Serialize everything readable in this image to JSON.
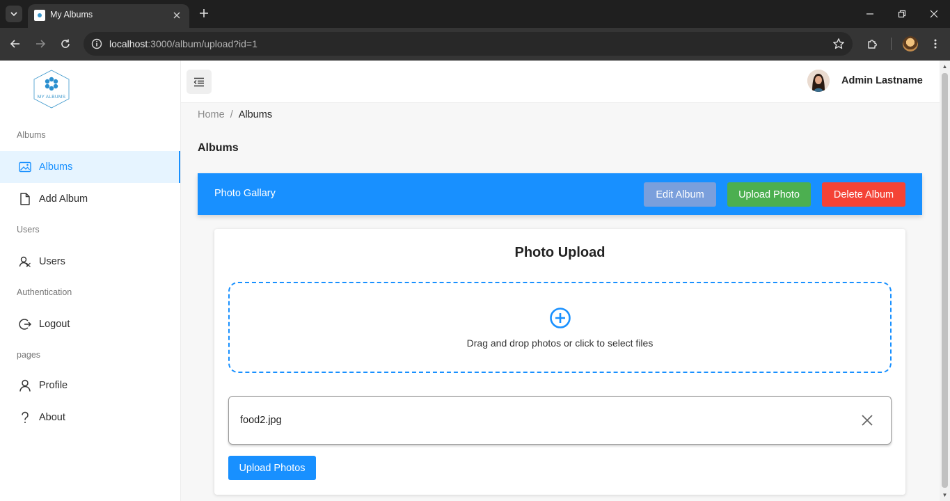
{
  "browser": {
    "tab_title": "My Albums",
    "url_host": "localhost",
    "url_rest": ":3000/album/upload?id=1"
  },
  "sidebar": {
    "logo_text": "MY ALBUMS",
    "sections": [
      {
        "title": "Albums"
      },
      {
        "title": "Users"
      },
      {
        "title": "Authentication"
      },
      {
        "title": "pages"
      }
    ],
    "items": [
      {
        "label": "Albums",
        "icon": "image-icon",
        "active": true
      },
      {
        "label": "Add Album",
        "icon": "file-icon"
      },
      {
        "label": "Users",
        "icon": "users-icon"
      },
      {
        "label": "Logout",
        "icon": "logout-icon"
      },
      {
        "label": "Profile",
        "icon": "user-icon"
      },
      {
        "label": "About",
        "icon": "question-icon"
      }
    ]
  },
  "header": {
    "user_name": "Admin Lastname"
  },
  "breadcrumb": {
    "home": "Home",
    "separator": "/",
    "current": "Albums"
  },
  "page": {
    "title": "Albums"
  },
  "album_bar": {
    "title": "Photo Gallary",
    "edit_label": "Edit Album",
    "upload_label": "Upload Photo",
    "delete_label": "Delete Album"
  },
  "upload": {
    "title": "Photo Upload",
    "dropzone_text": "Drag and drop photos or click to select files",
    "files": [
      "food2.jpg"
    ],
    "submit_label": "Upload Photos"
  },
  "colors": {
    "primary": "#1890ff",
    "edit": "#7a9fdc",
    "success": "#4caf50",
    "danger": "#f44336"
  }
}
